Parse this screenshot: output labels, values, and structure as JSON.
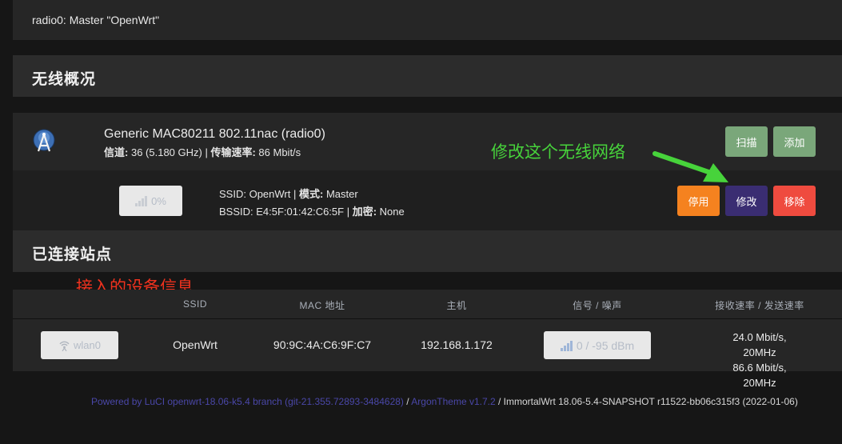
{
  "top": {
    "text": "radio0: Master \"OpenWrt\""
  },
  "wireless_overview": {
    "title": "无线概况",
    "radio": {
      "name": "Generic MAC80211 802.11nac (radio0)",
      "channel_label": "信道:",
      "channel_value": "36 (5.180 GHz)",
      "rate_label": "传输速率:",
      "rate_value": "86 Mbit/s",
      "scan_label": "扫描",
      "add_label": "添加"
    },
    "network": {
      "signal": "0%",
      "ssid_label": "SSID:",
      "ssid_value": "OpenWrt",
      "mode_label": "模式:",
      "mode_value": "Master",
      "bssid_label": "BSSID:",
      "bssid_value": "E4:5F:01:42:C6:5F",
      "encryption_label": "加密:",
      "encryption_value": "None",
      "disable_label": "停用",
      "edit_label": "修改",
      "remove_label": "移除"
    }
  },
  "annotations": {
    "edit_hint": "修改这个无线网络",
    "devices_hint": "接入的设备信息"
  },
  "associated": {
    "title": "已连接站点",
    "headers": [
      "SSID",
      "MAC 地址",
      "主机",
      "信号 / 噪声",
      "接收速率 / 发送速率"
    ],
    "rows": [
      {
        "iface": "wlan0",
        "ssid": "OpenWrt",
        "mac": "90:9C:4A:C6:9F:C7",
        "host": "192.168.1.172",
        "signal": "0 / -95 dBm",
        "rx": "24.0 Mbit/s, 20MHz",
        "tx": "86.6 Mbit/s, 20MHz"
      }
    ]
  },
  "footer": {
    "luci": "Powered by LuCI openwrt-18.06-k5.4 branch (git-21.355.72893-3484628)",
    "sep": " / ",
    "theme": "ArgonTheme v1.7.2",
    "build": " / ImmortalWrt 18.06-5.4-SNAPSHOT r11522-bb06c315f3 (2022-01-06)"
  },
  "colors": {
    "background": "#161616",
    "panel": "#262626",
    "green_button": "#7aa77a",
    "orange_button": "#f5821f",
    "purple_button": "#3a2d72",
    "red_button": "#ef4b3f",
    "annotation_green": "#47d33b",
    "annotation_red": "#f0321e",
    "link": "#4a47a8"
  },
  "icons": [
    "wifi-radio-icon",
    "signal-bars-icon",
    "wifi-iface-icon",
    "green-arrow-annotation"
  ]
}
